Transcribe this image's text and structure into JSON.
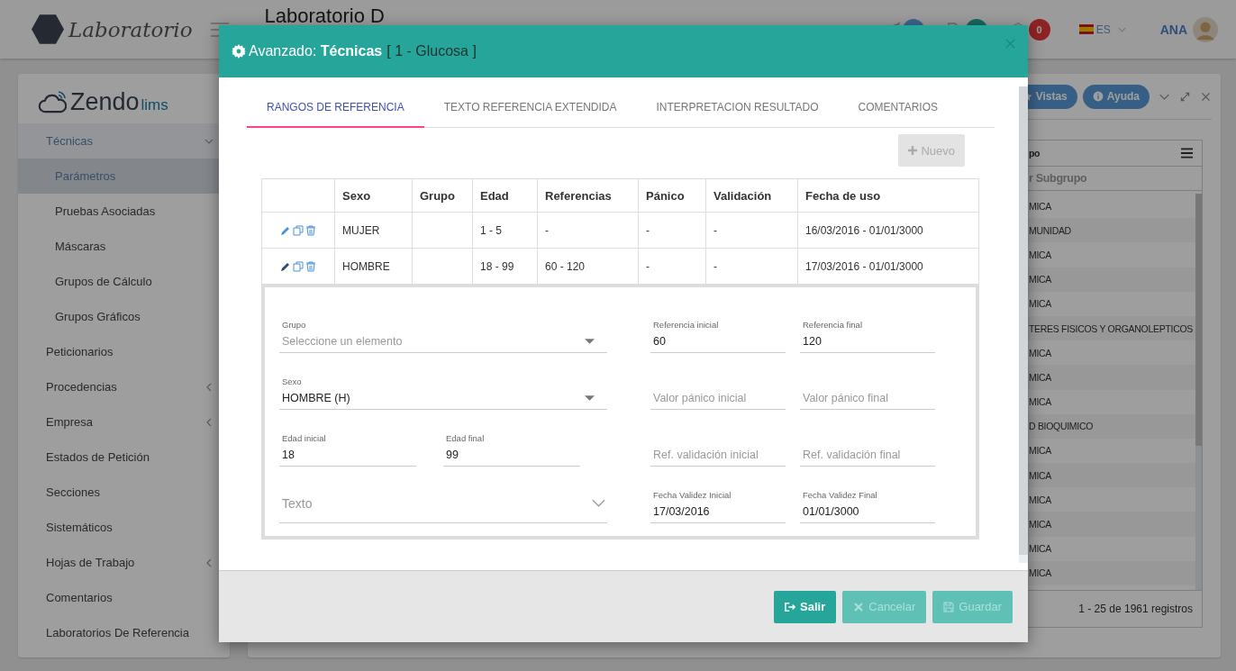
{
  "header": {
    "logo_text": "Laboratorio",
    "title": "Laboratorio D",
    "mail_badge": "0",
    "language": "ES",
    "user": "ANA"
  },
  "sidebar": {
    "brand": "Zendo",
    "brand_suffix": "lims",
    "items": [
      {
        "label": "Técnicas",
        "kind": "submenu",
        "expanded": true,
        "selected": false,
        "children": [
          {
            "label": "Parámetros",
            "selected": true
          },
          {
            "label": "Pruebas Asociadas",
            "selected": false
          },
          {
            "label": "Máscaras",
            "selected": false
          },
          {
            "label": "Grupos de Cálculo",
            "selected": false
          },
          {
            "label": "Grupos Gráficos",
            "selected": false
          }
        ]
      },
      {
        "label": "Peticionarios",
        "kind": "link",
        "selected": false
      },
      {
        "label": "Procedencias",
        "kind": "submenu",
        "expanded": false,
        "selected": false
      },
      {
        "label": "Empresa",
        "kind": "submenu",
        "expanded": false,
        "selected": false
      },
      {
        "label": "Estados de Petición",
        "kind": "link",
        "selected": false
      },
      {
        "label": "Secciones",
        "kind": "link",
        "selected": false
      },
      {
        "label": "Sistemáticos",
        "kind": "link",
        "selected": false
      },
      {
        "label": "Hojas de Trabajo",
        "kind": "submenu",
        "expanded": false,
        "selected": false
      },
      {
        "label": "Comentarios",
        "kind": "link",
        "selected": false
      },
      {
        "label": "Laboratorios De Referencia",
        "kind": "link",
        "selected": false
      }
    ]
  },
  "panel": {
    "buttons": [
      "Vistas",
      "Ayuda"
    ],
    "grid_header": "po",
    "filter_placeholder": "r Subgrupo",
    "rows": [
      "MICA",
      "MUNIDAD",
      "MICA",
      "MICA",
      "MICA",
      "TERES FISICOS Y ORGANOLEPTICOS",
      "MICA",
      "MICA",
      "MICA",
      "D BIOQUIMICO",
      "MICA",
      "MICA",
      "MICA",
      "MICA",
      "MICA",
      "MICA"
    ],
    "pager": "1 - 25 de 1961 registros"
  },
  "modal": {
    "title": "Avanzado: **Técnicas**",
    "subtitle": "[ 1 - Glucosa ]",
    "tabs": [
      {
        "label": "RANGOS DE REFERENCIA",
        "selected": true
      },
      {
        "label": "TEXTO REFERENCIA EXTENDIDA",
        "selected": false
      },
      {
        "label": "INTERPRETACION RESULTADO",
        "selected": false
      },
      {
        "label": "COMENTARIOS",
        "selected": false
      }
    ],
    "new_button": {
      "label": "Nuevo",
      "disabled": true
    },
    "table": {
      "columns": [
        "Sexo",
        "Grupo",
        "Edad",
        "Referencias",
        "Pánico",
        "Validación",
        "Fecha de uso"
      ],
      "rows": [
        {
          "cells": [
            "MUJER",
            "",
            "1 - 5",
            "-",
            "-",
            "-",
            "16/03/2016 - 01/01/3000"
          ]
        },
        {
          "cells": [
            "HOMBRE",
            "",
            "18 - 99",
            "60 - 120",
            "-",
            "-",
            "17/03/2016 - 01/01/3000"
          ]
        }
      ]
    },
    "form": {
      "rows": [
        {
          "left": [
            {
              "kind": "select",
              "label": "Grupo",
              "placeholder": "Seleccione un elemento"
            }
          ],
          "right": [
            {
              "kind": "input",
              "label": "Referencia inicial",
              "value": "60"
            },
            {
              "kind": "input",
              "label": "Referencia final",
              "value": "120"
            }
          ]
        },
        {
          "left": [
            {
              "kind": "select",
              "label": "Sexo",
              "value": "HOMBRE (H)"
            }
          ],
          "right": [
            {
              "kind": "input",
              "placeholder": "Valor pánico inicial"
            },
            {
              "kind": "input",
              "placeholder": "Valor pánico final"
            }
          ]
        },
        {
          "left": [
            {
              "kind": "input",
              "label": "Edad inicial",
              "value": "18"
            },
            {
              "kind": "input",
              "label": "Edad final",
              "value": "99"
            }
          ],
          "right": [
            {
              "kind": "input",
              "placeholder": "Ref. validación inicial"
            },
            {
              "kind": "input",
              "placeholder": "Ref. validación final"
            }
          ]
        },
        {
          "left": [
            {
              "kind": "combo",
              "placeholder": "Texto"
            }
          ],
          "right": [
            {
              "kind": "input",
              "label": "Fecha Validez Inicial",
              "value": "17/03/2016"
            },
            {
              "kind": "input",
              "label": "Fecha Validez Final",
              "value": "01/01/3000"
            }
          ]
        }
      ]
    },
    "footer_buttons": [
      {
        "label": "Salir",
        "kind": "exit",
        "disabled": false
      },
      {
        "label": "Cancelar",
        "kind": "cancel",
        "disabled": true
      },
      {
        "label": "Guardar",
        "kind": "save",
        "disabled": true
      }
    ]
  }
}
